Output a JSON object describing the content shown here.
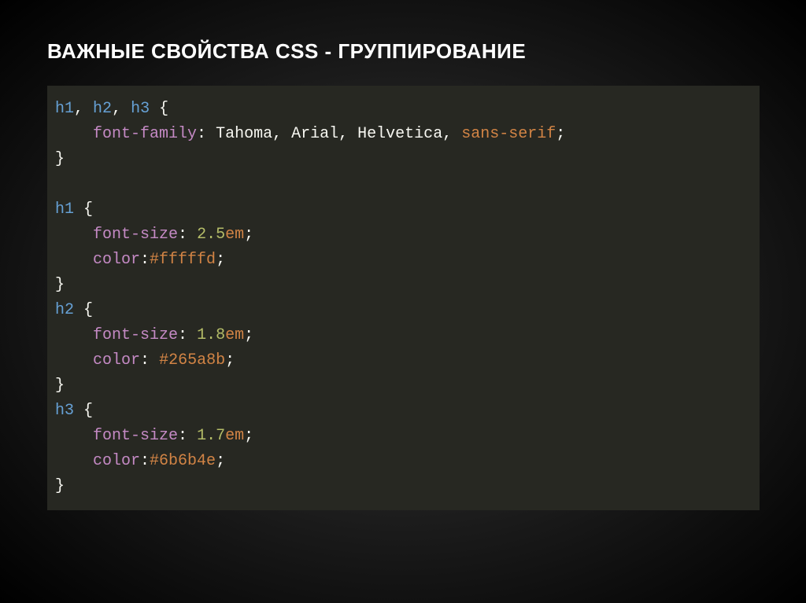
{
  "slide": {
    "title": "ВАЖНЫЕ СВОЙСТВА CSS - ГРУППИРОВАНИЕ"
  },
  "code": {
    "rule0": {
      "sel0": "h1",
      "sel1": "h2",
      "sel2": "h3",
      "comma0": ",",
      "comma1": ",",
      "open": "{",
      "prop0": "font-family",
      "colon0": ":",
      "val0a": "Tahoma",
      "c0a": ",",
      "val0b": "Arial",
      "c0b": ",",
      "val0c": "Helvetica",
      "c0c": ",",
      "val0d": "sans-serif",
      "semi0": ";",
      "close": "}"
    },
    "rule1": {
      "sel": "h1",
      "open": "{",
      "prop0": "font-size",
      "colon0": ":",
      "num0": "2.5",
      "unit0": "em",
      "semi0": ";",
      "prop1": "color",
      "colon1": ":",
      "hex1": "#fffffd",
      "semi1": ";",
      "close": "}"
    },
    "rule2": {
      "sel": "h2",
      "open": "{",
      "prop0": "font-size",
      "colon0": ":",
      "num0": "1.8",
      "unit0": "em",
      "semi0": ";",
      "prop1": "color",
      "colon1": ":",
      "hex1": "#265a8b",
      "semi1": ";",
      "close": "}"
    },
    "rule3": {
      "sel": "h3",
      "open": "{",
      "prop0": "font-size",
      "colon0": ":",
      "num0": "1.7",
      "unit0": "em",
      "semi0": ";",
      "prop1": "color",
      "colon1": ":",
      "hex1": "#6b6b4e",
      "semi1": ";",
      "close": "}"
    }
  }
}
